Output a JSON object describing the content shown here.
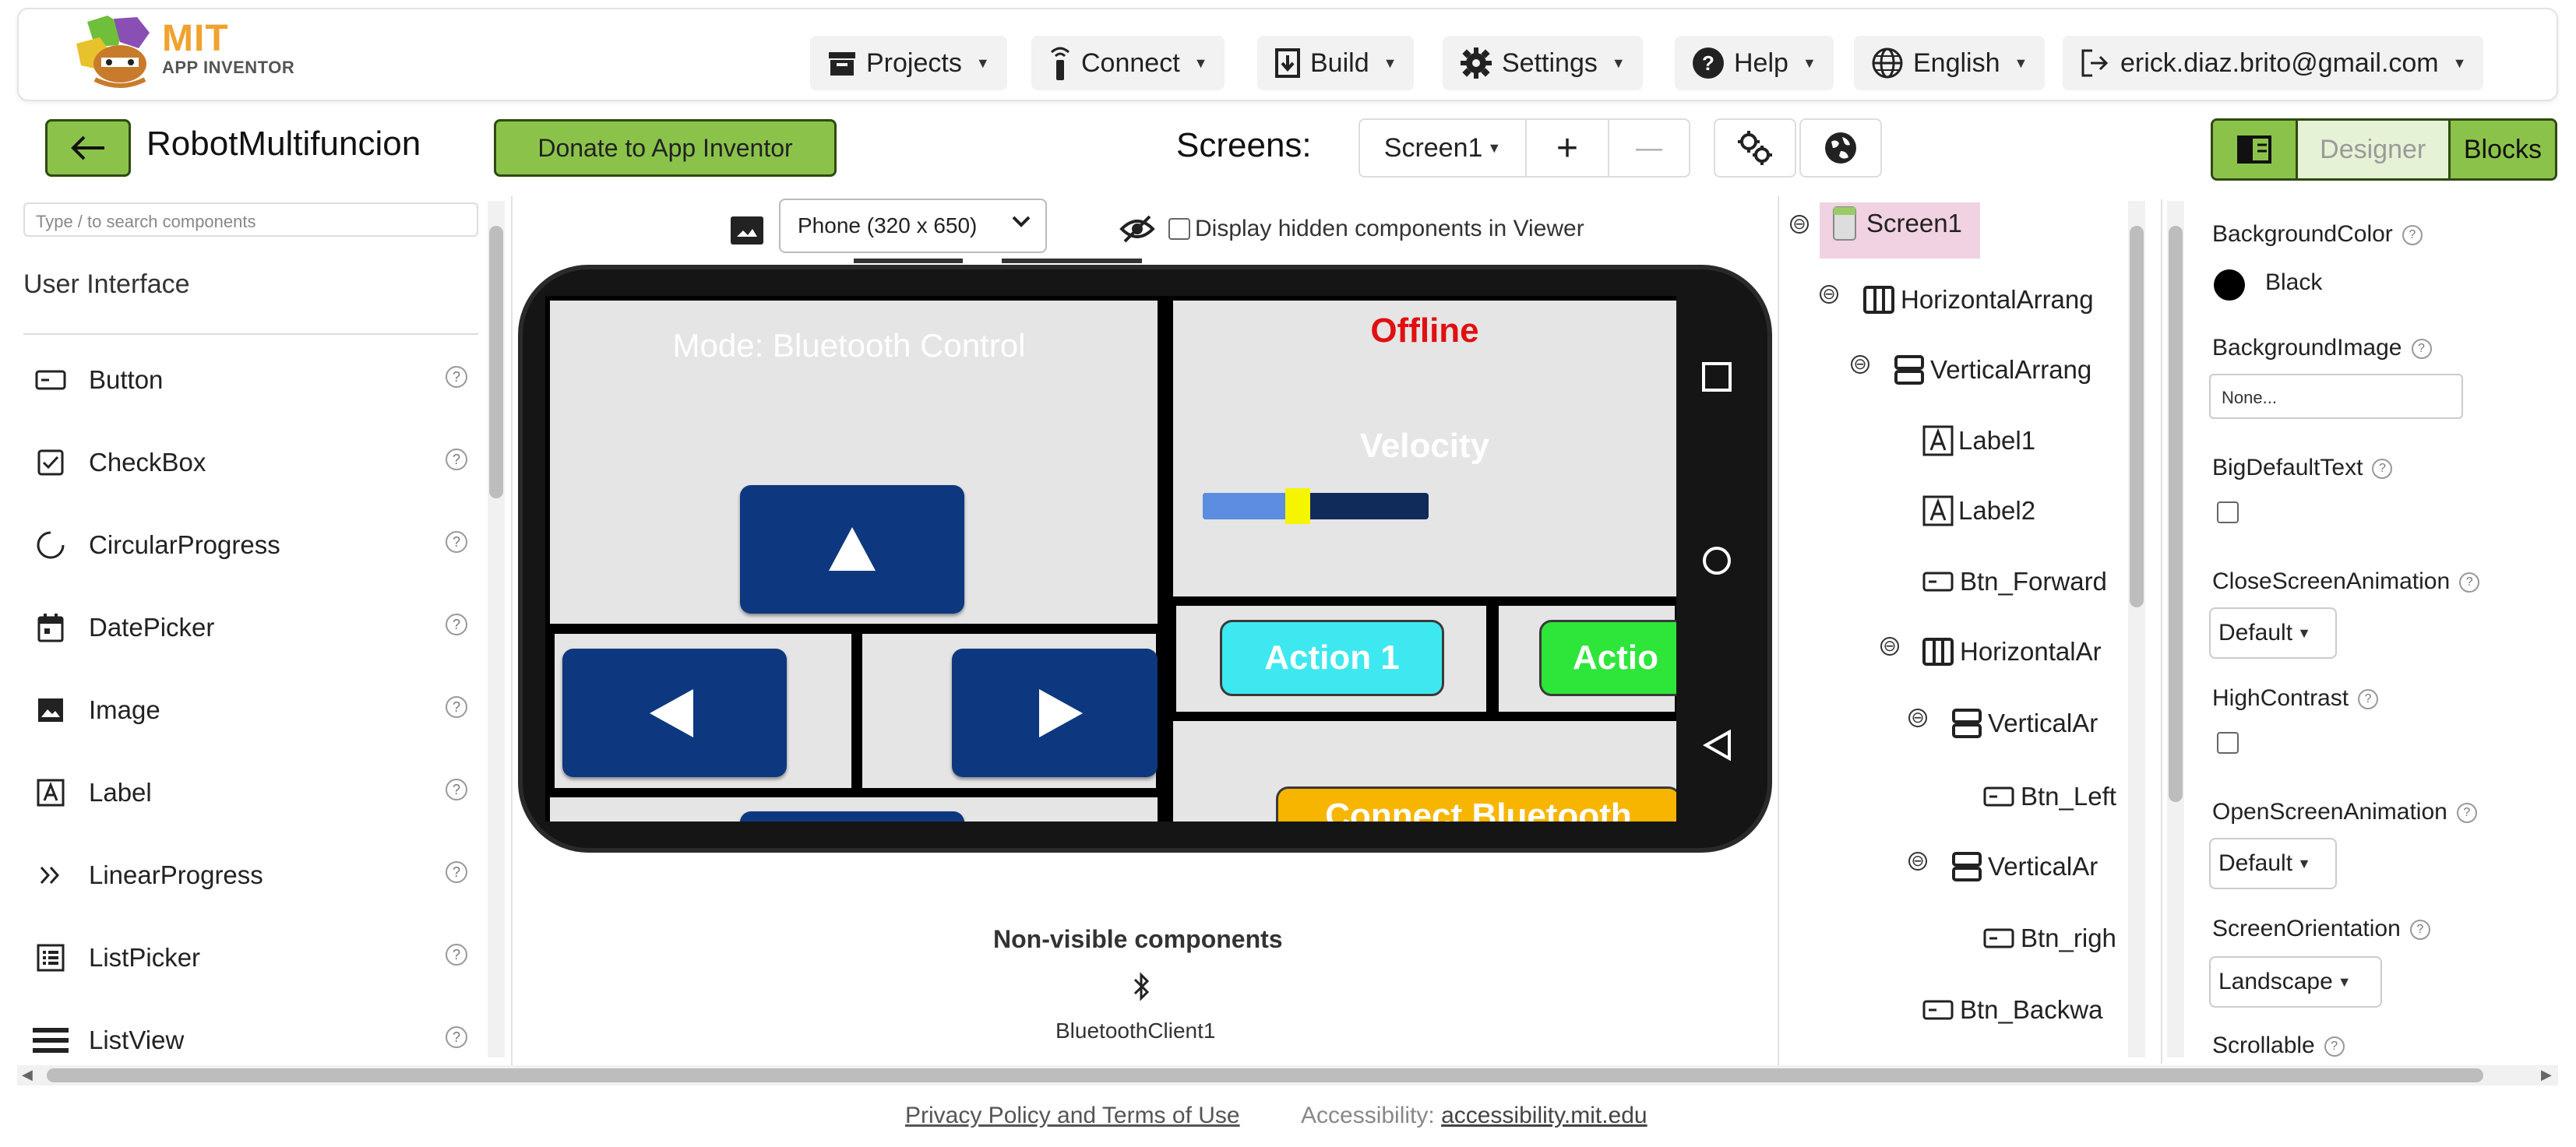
{
  "nav": {
    "logo_line1": "MIT",
    "logo_line2": "APP INVENTOR",
    "projects": "Projects",
    "connect": "Connect",
    "build": "Build",
    "settings": "Settings",
    "help": "Help",
    "language": "English",
    "account": "erick.diaz.brito@gmail.com"
  },
  "toolbar": {
    "project_name": "RobotMultifuncion",
    "donate": "Donate to App Inventor",
    "screens_label": "Screens:",
    "screen_selected": "Screen1",
    "add_screen": "+",
    "remove_screen": "—",
    "designer": "Designer",
    "blocks": "Blocks"
  },
  "palette": {
    "search_placeholder": "Type / to search components",
    "category": "User Interface",
    "items": [
      {
        "label": "Button",
        "icon": "button-icon"
      },
      {
        "label": "CheckBox",
        "icon": "checkbox-icon"
      },
      {
        "label": "CircularProgress",
        "icon": "circular-progress-icon"
      },
      {
        "label": "DatePicker",
        "icon": "calendar-icon"
      },
      {
        "label": "Image",
        "icon": "image-icon"
      },
      {
        "label": "Label",
        "icon": "label-icon"
      },
      {
        "label": "LinearProgress",
        "icon": "double-chevron-icon"
      },
      {
        "label": "ListPicker",
        "icon": "list-picker-icon"
      },
      {
        "label": "ListView",
        "icon": "list-view-icon"
      }
    ],
    "help_glyph": "?"
  },
  "viewer": {
    "phone_size": "Phone (320 x 650)",
    "hidden_label": "Display hidden components in Viewer",
    "mode_label": "Mode: Bluetooth Control",
    "status_label": "Offline",
    "velocity_label": "Velocity",
    "velocity_level": 0.42,
    "action1": "Action 1",
    "action2": "Actio",
    "connect_bt": "Connect Bluetooth",
    "nonvisible_title": "Non-visible components",
    "nonvisible_item": "BluetoothClient1",
    "colors": {
      "navy": "#0d3880",
      "cyan": "#3ee8f0",
      "green": "#2ee63a",
      "orange": "#f7b500",
      "status_red": "#e01010"
    }
  },
  "tree": {
    "items": [
      "Screen1",
      "HorizontalArrang",
      "VerticalArrang",
      "Label1",
      "Label2",
      "Btn_Forward",
      "HorizontalAr",
      "VerticalAr",
      "Btn_Left",
      "VerticalAr",
      "Btn_righ",
      "Btn_Backwa"
    ],
    "collapse_glyph": "⊖"
  },
  "props": {
    "bg_color_label": "BackgroundColor",
    "bg_color_value": "Black",
    "bg_image_label": "BackgroundImage",
    "bg_image_value": "None...",
    "big_text_label": "BigDefaultText",
    "close_anim_label": "CloseScreenAnimation",
    "close_anim_value": "Default",
    "high_contrast_label": "HighContrast",
    "open_anim_label": "OpenScreenAnimation",
    "open_anim_value": "Default",
    "orientation_label": "ScreenOrientation",
    "orientation_value": "Landscape",
    "scrollable_label": "Scrollable"
  },
  "footer": {
    "privacy": "Privacy Policy and Terms of Use",
    "accessibility_label": "Accessibility:",
    "accessibility_link": "accessibility.mit.edu"
  }
}
